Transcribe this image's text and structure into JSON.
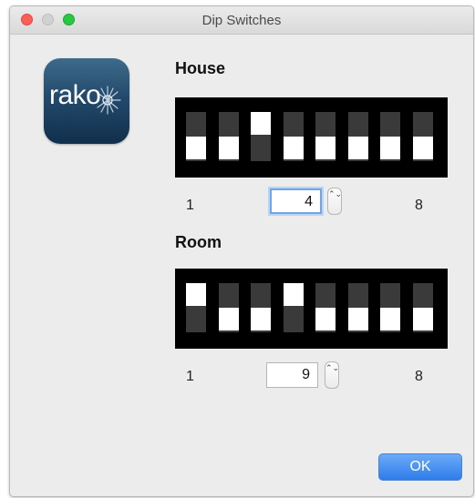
{
  "window": {
    "title": "Dip Switches"
  },
  "logo": {
    "text": "rako",
    "brand_colors": [
      "#3f6a8a",
      "#102f4c"
    ]
  },
  "house": {
    "label": "House",
    "switches": [
      "off",
      "off",
      "on",
      "off",
      "off",
      "off",
      "off",
      "off"
    ],
    "scale_min": "1",
    "scale_max": "8",
    "value": "4"
  },
  "room": {
    "label": "Room",
    "switches": [
      "on",
      "off",
      "off",
      "on",
      "off",
      "off",
      "off",
      "off"
    ],
    "scale_min": "1",
    "scale_max": "8",
    "value": "9"
  },
  "stepper": {
    "arrows": "⌃⌄",
    "icon": "stepper-arrows-icon"
  },
  "buttons": {
    "ok_label": "OK"
  },
  "colors": {
    "accent": "#2f7ce9",
    "focus_ring": "#6fa6ea"
  }
}
